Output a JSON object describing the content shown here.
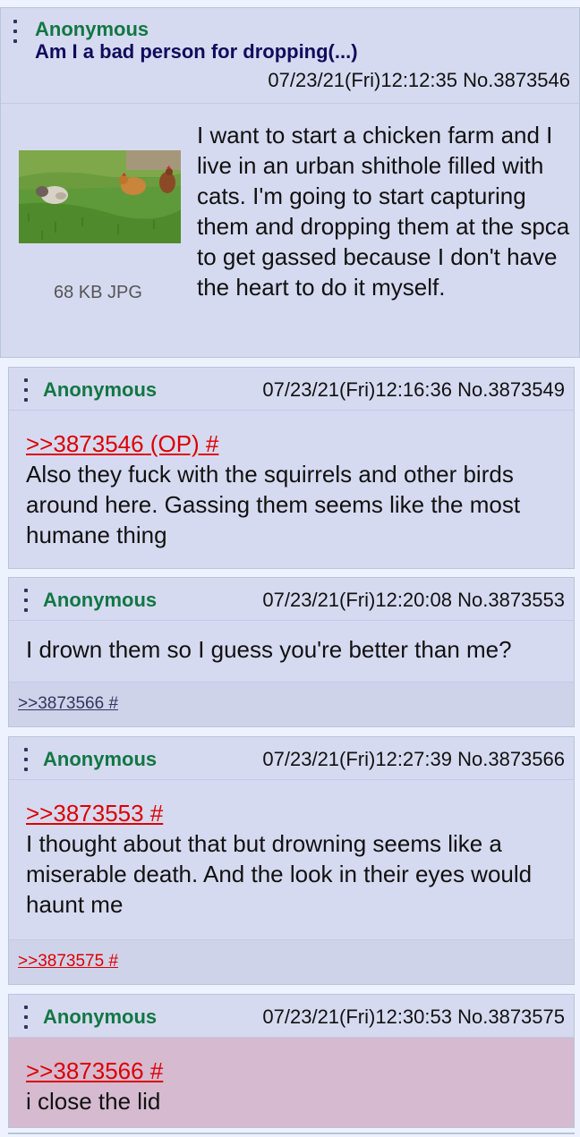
{
  "op": {
    "name": "Anonymous",
    "subject": "Am I a bad person for dropping(...)",
    "datetime": "07/23/21(Fri)12:12:35",
    "number": "No.3873546",
    "file": {
      "info": "68 KB JPG",
      "thumbnail_icon": "image-thumbnail-icon"
    },
    "text": "I want to start a chicken farm and I live in an urban shithole filled with cats. I'm going to start capturing them and dropping them at the spca to get gassed because I don't have the heart to do it myself."
  },
  "replies": [
    {
      "name": "Anonymous",
      "datetime": "07/23/21(Fri)12:16:36",
      "number": "No.3873549",
      "quote": ">>3873546 (OP) #",
      "text": "Also they fuck with the squirrels and other birds around here. Gassing them seems like the most humane thing"
    },
    {
      "name": "Anonymous",
      "datetime": "07/23/21(Fri)12:20:08",
      "number": "No.3873553",
      "text": "I drown them so I guess you're better than me?",
      "backlink": ">>3873566 #"
    },
    {
      "name": "Anonymous",
      "datetime": "07/23/21(Fri)12:27:39",
      "number": "No.3873566",
      "quote": ">>3873553 #",
      "text": "I thought about that but drowning seems like a miserable death. And the look in their eyes would haunt me",
      "backlink": ">>3873575 #"
    },
    {
      "name": "Anonymous",
      "datetime": "07/23/21(Fri)12:30:53",
      "number": "No.3873575",
      "quote": ">>3873566 #",
      "text": "i close the lid"
    }
  ],
  "colors": {
    "name": "#117743",
    "subject": "#0f0c5d",
    "quotelink": "#dd0000",
    "post_bg": "#d6daf0",
    "highlight_bg": "#d6bad0"
  }
}
